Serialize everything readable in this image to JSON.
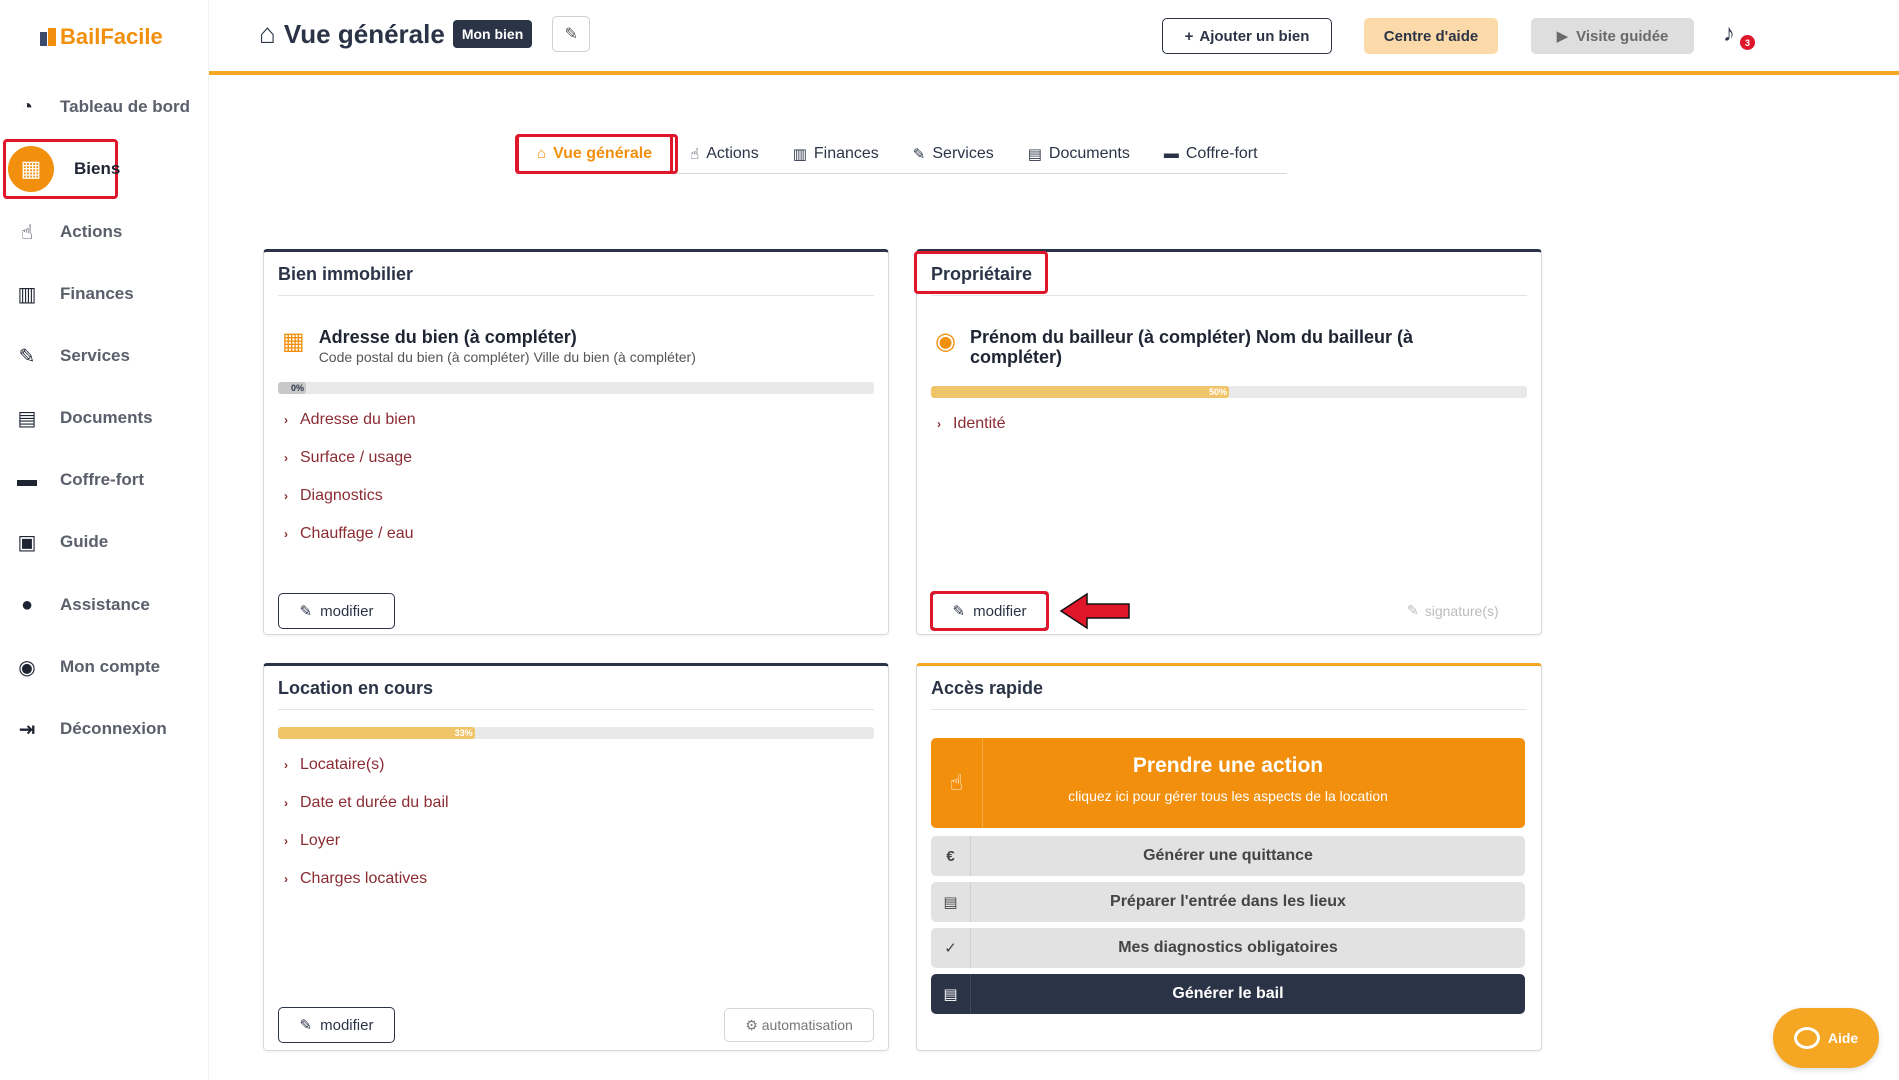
{
  "brand": {
    "name": "BailFacile"
  },
  "sidebar": {
    "items": [
      {
        "label": "Tableau de bord",
        "icon": "dashboard-icon",
        "glyph": "◔"
      },
      {
        "label": "Biens",
        "icon": "building-icon",
        "glyph": "▦",
        "active": true
      },
      {
        "label": "Actions",
        "icon": "hand-pointer-icon",
        "glyph": "☝"
      },
      {
        "label": "Finances",
        "icon": "bar-chart-icon",
        "glyph": "▥"
      },
      {
        "label": "Services",
        "icon": "wrench-icon",
        "glyph": "✎"
      },
      {
        "label": "Documents",
        "icon": "document-icon",
        "glyph": "▤"
      },
      {
        "label": "Coffre-fort",
        "icon": "archive-icon",
        "glyph": "▬"
      },
      {
        "label": "Guide",
        "icon": "book-icon",
        "glyph": "▣"
      },
      {
        "label": "Assistance",
        "icon": "chat-icon",
        "glyph": "●"
      },
      {
        "label": "Mon compte",
        "icon": "user-icon",
        "glyph": "◉"
      },
      {
        "label": "Déconnexion",
        "icon": "logout-icon",
        "glyph": "⇥"
      }
    ]
  },
  "header": {
    "title": "Vue générale",
    "badge": "Mon bien",
    "add_label": "Ajouter un bien",
    "help_label": "Centre d'aide",
    "tour_label": "Visite guidée",
    "notif_count": "3"
  },
  "tabs": [
    {
      "label": "Vue générale",
      "glyph": "⌂",
      "active": true
    },
    {
      "label": "Actions",
      "glyph": "☝"
    },
    {
      "label": "Finances",
      "glyph": "▥"
    },
    {
      "label": "Services",
      "glyph": "✎"
    },
    {
      "label": "Documents",
      "glyph": "▤"
    },
    {
      "label": "Coffre-fort",
      "glyph": "▬"
    }
  ],
  "bien": {
    "title": "Bien immobilier",
    "address": "Adresse du bien (à compléter)",
    "city": "Code postal du bien (à compléter) Ville du bien (à compléter)",
    "progress": 0,
    "progress_label": "0%",
    "links": [
      "Adresse du bien",
      "Surface / usage",
      "Diagnostics",
      "Chauffage / eau"
    ],
    "modify_label": "modifier"
  },
  "proprietaire": {
    "title": "Propriétaire",
    "name": "Prénom du bailleur (à compléter) Nom du bailleur (à compléter)",
    "progress": 50,
    "progress_label": "50%",
    "links": [
      "Identité"
    ],
    "modify_label": "modifier",
    "signature_label": "signature(s)"
  },
  "location": {
    "title": "Location en cours",
    "progress": 33,
    "progress_label": "33%",
    "links": [
      "Locataire(s)",
      "Date et durée du bail",
      "Loyer",
      "Charges locatives"
    ],
    "modify_label": "modifier",
    "automation_label": "automatisation"
  },
  "acces": {
    "title": "Accès rapide",
    "action_title": "Prendre une action",
    "action_sub": "cliquez ici pour gérer tous les aspects de la location",
    "buttons": [
      {
        "label": "Générer une quittance",
        "glyph": "€"
      },
      {
        "label": "Préparer l'entrée dans les lieux",
        "glyph": "▤"
      },
      {
        "label": "Mes diagnostics obligatoires",
        "glyph": "✓"
      },
      {
        "label": "Générer le bail",
        "glyph": "▤"
      }
    ]
  },
  "aide": {
    "label": "Aide"
  },
  "colors": {
    "accent": "#f28f0c",
    "dark": "#2b3447",
    "highlight": "#e0162b",
    "link": "#8b2c33"
  }
}
